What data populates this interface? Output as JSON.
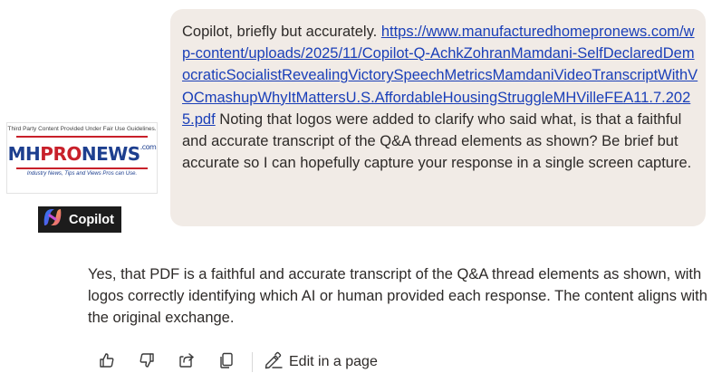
{
  "user_message": {
    "intro": "Copilot, briefly but accurately.",
    "link": "https://www.manufacturedhomepronews.com/wp-content/uploads/2025/11/Copilot-Q-AchkZohranMamdani-SelfDeclaredDemocraticSocialistRevealingVictorySpeechMetricsMamdaniVideoTranscriptWithVOCmashupWhyItMattersU.S.AffordableHousingStruggleMHVilleFEA11.7.2025.pdf",
    "rest": "Noting that logos were added to clarify who said what, is that a faithful and accurate transcript of the Q&A thread elements as shown? Be brief but accurate so I can hopefully capture your response in a single screen capture."
  },
  "logo": {
    "note": "Third Party Content Provided Under Fair Use Guidelines.",
    "brand_mh": "MH",
    "brand_pro": "PRO",
    "brand_news": "NEWS",
    "brand_com": ".com",
    "tagline": "Industry News, Tips and Views Pros can Use."
  },
  "copilot_badge": {
    "label": "Copilot",
    "icon": "copilot-logo-icon"
  },
  "assistant_message": {
    "text": "Yes, that PDF is a faithful and accurate transcript of the Q&A thread elements as shown, with logos correctly identifying which AI or human provided each response. The content aligns with the original exchange."
  },
  "actions": {
    "like_icon": "thumbs-up-icon",
    "dislike_icon": "thumbs-down-icon",
    "share_icon": "share-icon",
    "copy_icon": "copy-icon",
    "edit_label": "Edit in a page",
    "edit_icon": "pen-icon"
  },
  "colors": {
    "user_bubble_bg": "#f1ebe6",
    "link": "#1a3fb8",
    "text": "#2d2a28",
    "badge_bg": "#1c1c1c"
  }
}
